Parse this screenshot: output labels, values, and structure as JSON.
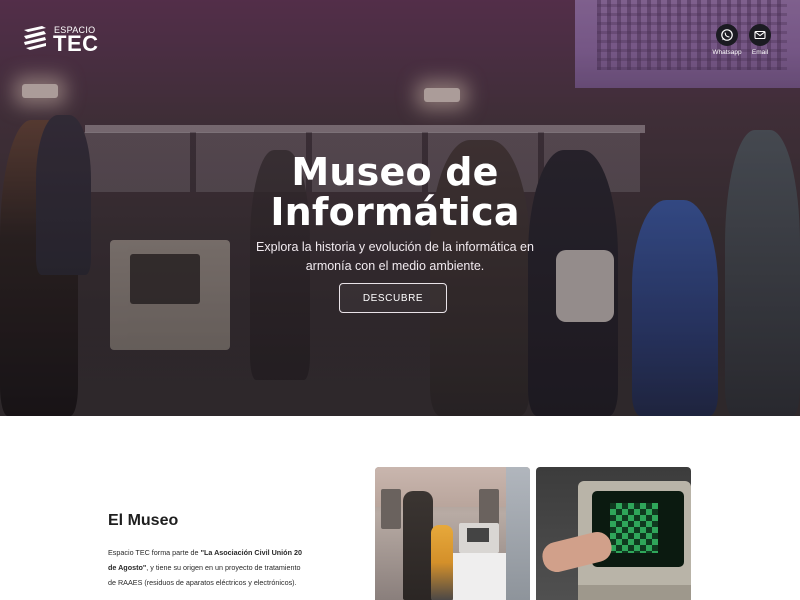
{
  "header": {
    "logo_small": "ESPACIO",
    "logo_big": "TEC",
    "contacts": [
      {
        "label": "Whatsapp",
        "icon": "whatsapp-icon"
      },
      {
        "label": "Email",
        "icon": "mail-icon"
      }
    ]
  },
  "hero": {
    "title_line1": "Museo de",
    "title_line2": "Informática",
    "subtitle": "Explora la historia y evolución de la informática en armonía con el medio ambiente.",
    "cta_label": "DESCUBRE"
  },
  "museo": {
    "heading": "El Museo",
    "text_prefix": "Espacio TEC forma parte de ",
    "text_bold": "\"La Asociación Civil Unión 20 de Agosto\"",
    "text_suffix": ", y tiene su origen en un proyecto de tratamiento de RAAES (residuos de aparatos eléctricos y electrónicos)."
  },
  "colors": {
    "hero_overlay": "#5e3a53",
    "button_border": "#e9e3e8",
    "contact_circle": "#1b1b22",
    "text_dark": "#1e1e1e"
  }
}
